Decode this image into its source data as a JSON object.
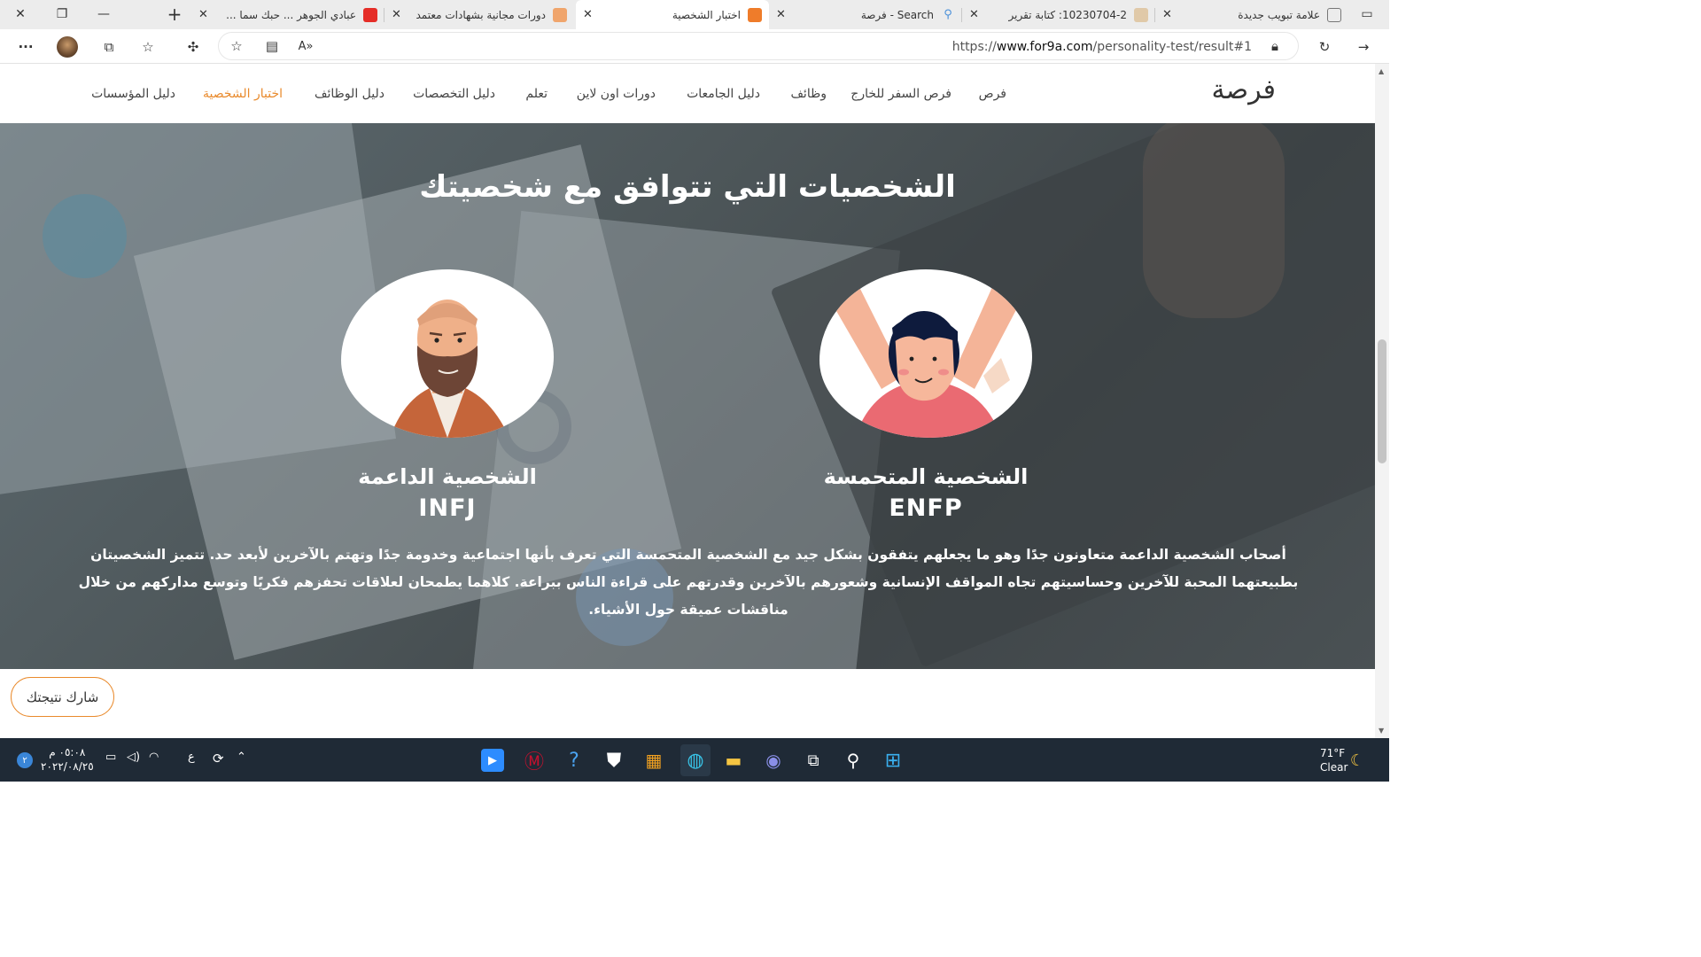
{
  "browser": {
    "tabs": [
      {
        "title": "علامة تبويب جديدة",
        "active": false
      },
      {
        "title": "10230704-2: كتابة تقرير",
        "active": false
      },
      {
        "title": "Search - فرصة",
        "active": false
      },
      {
        "title": "اختبار الشخصية",
        "active": true
      },
      {
        "title": "دورات مجانية بشهادات معتمد",
        "active": false
      },
      {
        "title": "عبادي الجوهر ... حبك سما ...",
        "active": false
      }
    ],
    "url_prefix": "https://",
    "url_host": "www.for9a.com",
    "url_path": "/personality-test/result#1"
  },
  "site": {
    "logo_text": "فرصة",
    "nav": [
      "فرص",
      "فرص السفر للخارج",
      "وظائف",
      "دليل الجامعات",
      "دورات اون لاين",
      "تعلم",
      "دليل التخصصات",
      "دليل الوظائف",
      "اختبار الشخصية",
      "دليل المؤسسات"
    ],
    "active_nav": "اختبار الشخصية"
  },
  "hero": {
    "title": "الشخصيات التي تتوافق مع شخصيتك",
    "types": [
      {
        "name": "الشخصية المتحمسة",
        "code": "ENFP"
      },
      {
        "name": "الشخصية الداعمة",
        "code": "INFJ"
      }
    ],
    "description": "أصحاب الشخصية الداعمة متعاونون جدًا وهو ما يجعلهم يتفقون بشكل جيد مع الشخصية المتحمسة التي تعرف بأنها اجتماعية وخدومة جدًا وتهتم بالآخرين لأبعد حد. تتميز الشخصيتان بطبيعتهما المحبة للآخرين وحساسيتهم تجاه المواقف الإنسانية وشعورهم بالآخرين وقدرتهم على قراءة الناس ببراعة. كلاهما يطمحان لعلاقات تحفزهم فكريًا وتوسع مداركهم من خلال مناقشات عميقة حول الأشياء."
  },
  "share_label": "شارك نتيجتك",
  "taskbar": {
    "weather_temp": "71°F",
    "weather_text": "Clear",
    "time": "٠٥:٠٨ م",
    "date": "٢٠٢٢/٠٨/٢٥",
    "lang": "ع",
    "notification_count": "٢"
  },
  "colors": {
    "accent": "#e98a2c",
    "taskbar": "#1f2a36"
  }
}
